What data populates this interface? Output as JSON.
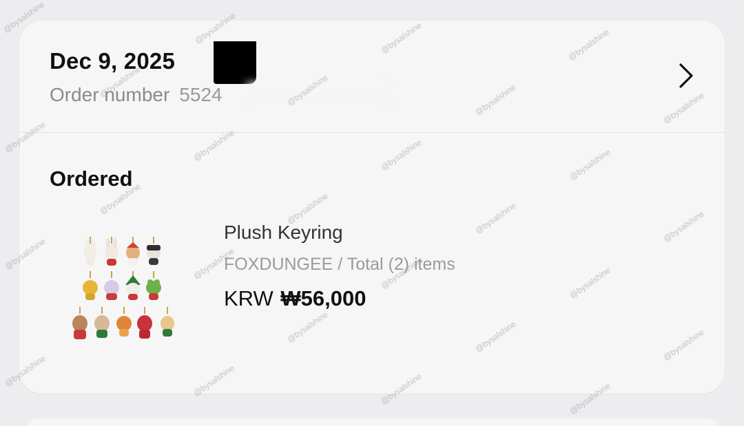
{
  "order": {
    "date": "Dec 9, 2025",
    "number_label": "Order number",
    "number_value": "5524"
  },
  "section": {
    "title": "Ordered"
  },
  "product": {
    "name": "Plush Keyring",
    "meta": "FOXDUNGEE / Total (2) items",
    "currency": "KRW",
    "price": "₩56,000"
  },
  "watermark": "@bysalshine",
  "icons": {
    "chevron": "chevron-right-icon"
  }
}
